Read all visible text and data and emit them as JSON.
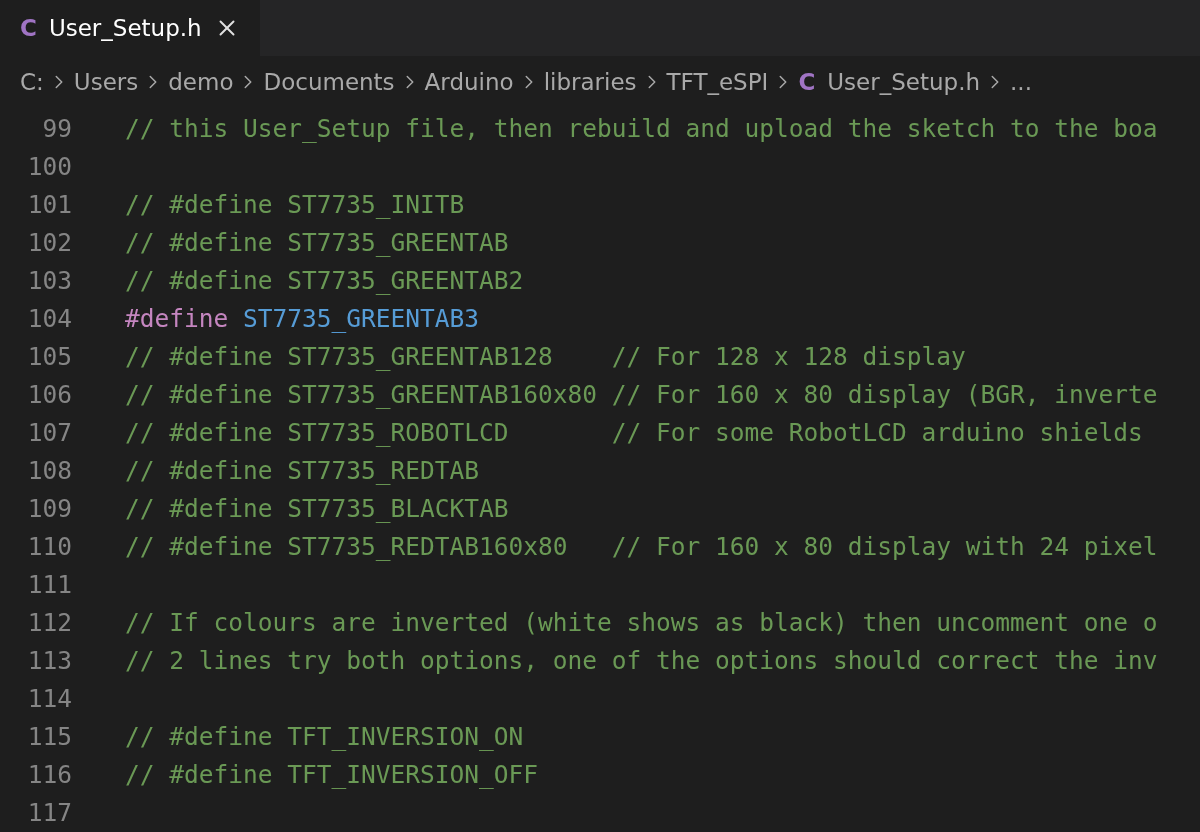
{
  "tabs": [
    {
      "label": "User_Setup.h",
      "icon": "C",
      "selected": true
    }
  ],
  "breadcrumb": [
    {
      "label": "C:"
    },
    {
      "label": "Users"
    },
    {
      "label": "demo"
    },
    {
      "label": "Documents"
    },
    {
      "label": "Arduino"
    },
    {
      "label": "libraries"
    },
    {
      "label": "TFT_eSPI"
    },
    {
      "label": "User_Setup.h",
      "icon": "C"
    },
    {
      "label": "..."
    }
  ],
  "lines": [
    {
      "number": "99",
      "tokens": [
        {
          "kind": "comment",
          "text": "// this User_Setup file, then rebuild and upload the sketch to the boa"
        }
      ]
    },
    {
      "number": "100"
    },
    {
      "number": "101",
      "tokens": [
        {
          "kind": "comment",
          "text": "// #define ST7735_INITB"
        }
      ]
    },
    {
      "number": "102",
      "tokens": [
        {
          "kind": "comment",
          "text": "// #define ST7735_GREENTAB"
        }
      ]
    },
    {
      "number": "103",
      "tokens": [
        {
          "kind": "comment",
          "text": "// #define ST7735_GREENTAB2"
        }
      ]
    },
    {
      "number": "104",
      "tokens": [
        {
          "kind": "keyword",
          "text": "#define"
        },
        {
          "kind": "macro",
          "text": " ST7735_GREENTAB3"
        }
      ]
    },
    {
      "number": "105",
      "tokens": [
        {
          "kind": "comment",
          "text": "// #define ST7735_GREENTAB128    // For 128 x 128 display"
        }
      ]
    },
    {
      "number": "106",
      "tokens": [
        {
          "kind": "comment",
          "text": "// #define ST7735_GREENTAB160x80 // For 160 x 80 display (BGR, inverte"
        }
      ]
    },
    {
      "number": "107",
      "tokens": [
        {
          "kind": "comment",
          "text": "// #define ST7735_ROBOTLCD       // For some RobotLCD arduino shields"
        }
      ]
    },
    {
      "number": "108",
      "tokens": [
        {
          "kind": "comment",
          "text": "// #define ST7735_REDTAB"
        }
      ]
    },
    {
      "number": "109",
      "tokens": [
        {
          "kind": "comment",
          "text": "// #define ST7735_BLACKTAB"
        }
      ]
    },
    {
      "number": "110",
      "tokens": [
        {
          "kind": "comment",
          "text": "// #define ST7735_REDTAB160x80   // For 160 x 80 display with 24 pixel"
        }
      ]
    },
    {
      "number": "111"
    },
    {
      "number": "112",
      "tokens": [
        {
          "kind": "comment",
          "text": "// If colours are inverted (white shows as black) then uncomment one o"
        }
      ]
    },
    {
      "number": "113",
      "tokens": [
        {
          "kind": "comment",
          "text": "// 2 lines try both options, one of the options should correct the inv"
        }
      ]
    },
    {
      "number": "114"
    },
    {
      "number": "115",
      "tokens": [
        {
          "kind": "comment",
          "text": "// #define TFT_INVERSION_ON"
        }
      ]
    },
    {
      "number": "116",
      "tokens": [
        {
          "kind": "comment",
          "text": "// #define TFT_INVERSION_OFF"
        }
      ]
    },
    {
      "number": "117"
    }
  ]
}
